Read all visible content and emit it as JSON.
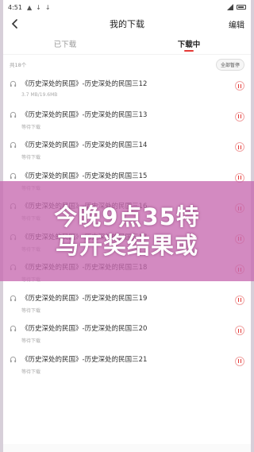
{
  "status_bar": {
    "time": "4:51"
  },
  "header": {
    "title": "我的下载",
    "edit_label": "编辑"
  },
  "tabs": [
    {
      "label": "已下载",
      "active": false
    },
    {
      "label": "下载中",
      "active": true
    }
  ],
  "list_header": {
    "count_text": "共18个",
    "pause_all_label": "全部暂停"
  },
  "downloads": [
    {
      "title": "《历史深处的民国》-历史深处的民国三12",
      "status": "3.7 MB/19.6MB"
    },
    {
      "title": "《历史深处的民国》-历史深处的民国三13",
      "status": "等待下载"
    },
    {
      "title": "《历史深处的民国》-历史深处的民国三14",
      "status": "等待下载"
    },
    {
      "title": "《历史深处的民国》-历史深处的民国三15",
      "status": "等待下载"
    },
    {
      "title": "《历史深处的民国》-历史深处的民国三16",
      "status": "等待下载"
    },
    {
      "title": "《历史深处的民国》-历史深处的民国三17",
      "status": "等待下载"
    },
    {
      "title": "《历史深处的民国》-历史深处的民国三18",
      "status": "等待下载"
    },
    {
      "title": "《历史深处的民国》-历史深处的民国三19",
      "status": "等待下载"
    },
    {
      "title": "《历史深处的民国》-历史深处的民国三20",
      "status": "等待下载"
    },
    {
      "title": "《历史深处的民国》-历史深处的民国三21",
      "status": "等待下载"
    }
  ],
  "overlay": {
    "line1": "今晚9点35特",
    "line2": "马开奖结果或"
  },
  "colors": {
    "accent": "#e53935",
    "overlay": "#c669b0"
  },
  "icons": {
    "back": "chevron-left-icon",
    "item": "headphones-icon",
    "control": "pause-icon"
  }
}
